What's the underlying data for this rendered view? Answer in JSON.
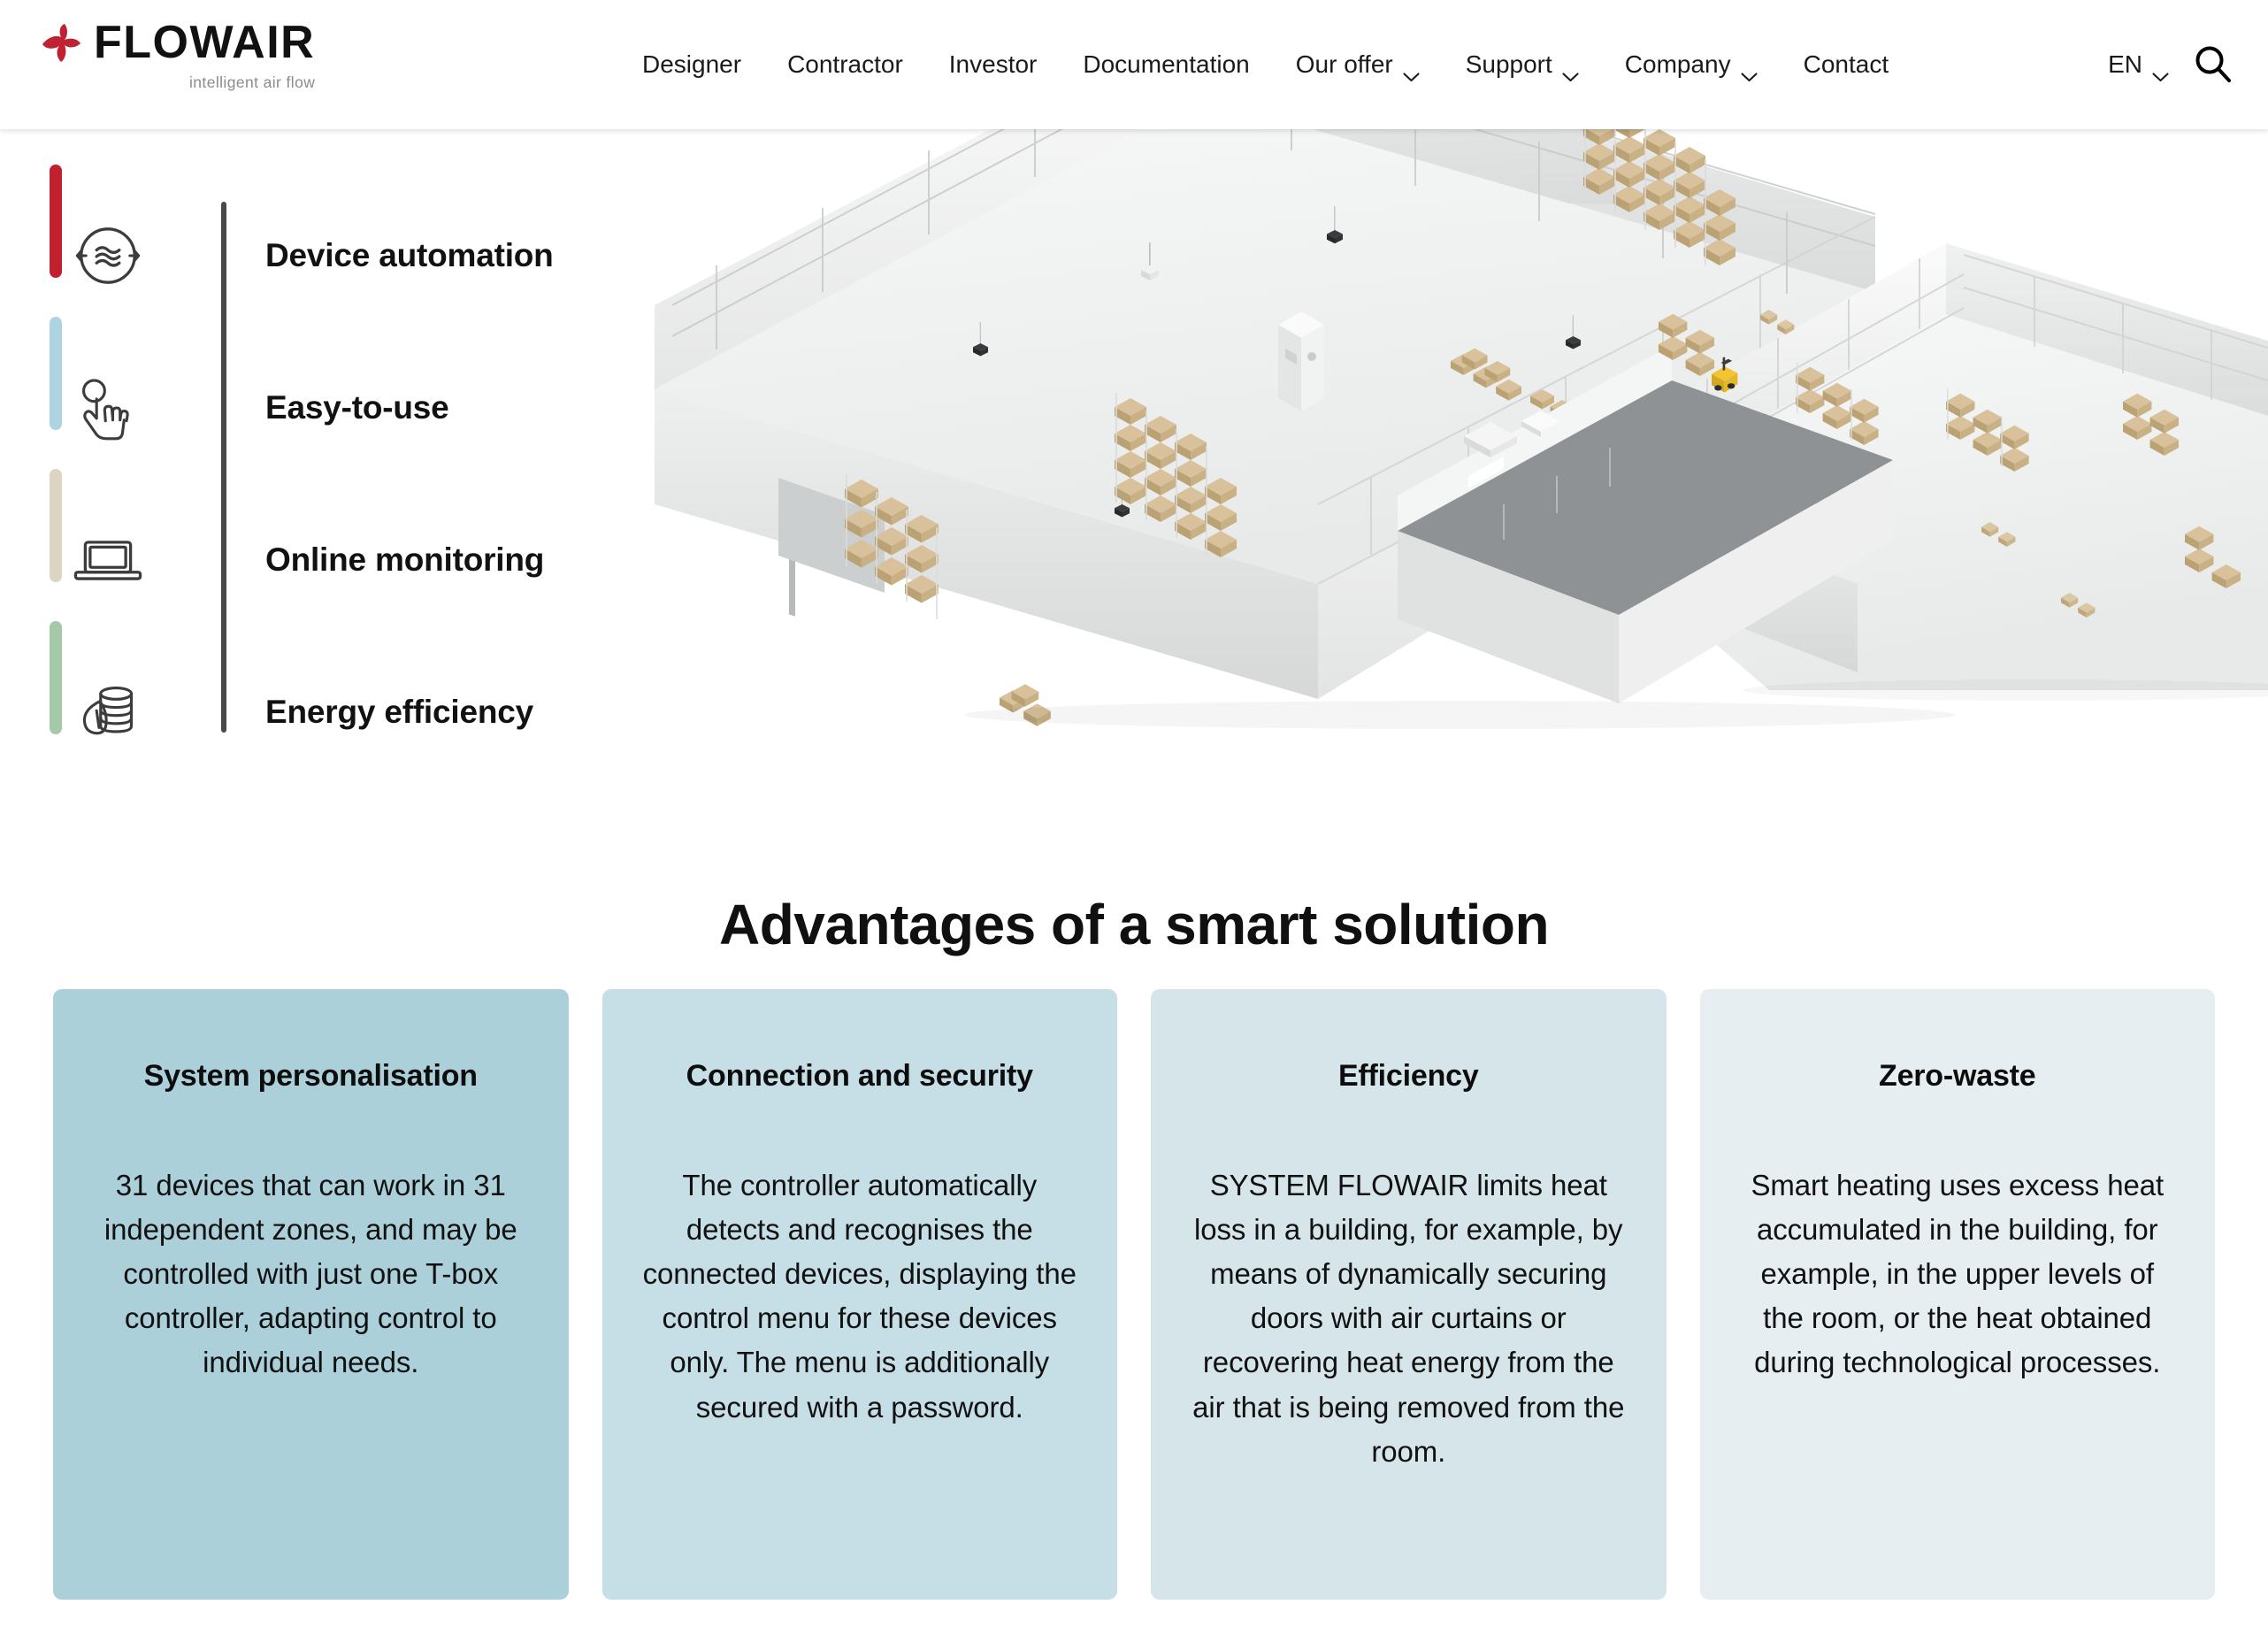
{
  "brand": {
    "name": "FLOWAIR",
    "tagline": "intelligent air flow",
    "mark_color": "#bf2233"
  },
  "nav": {
    "items": [
      {
        "label": "Designer",
        "has_dropdown": false
      },
      {
        "label": "Contractor",
        "has_dropdown": false
      },
      {
        "label": "Investor",
        "has_dropdown": false
      },
      {
        "label": "Documentation",
        "has_dropdown": false
      },
      {
        "label": "Our offer",
        "has_dropdown": true
      },
      {
        "label": "Support",
        "has_dropdown": true
      },
      {
        "label": "Company",
        "has_dropdown": true
      },
      {
        "label": "Contact",
        "has_dropdown": false
      }
    ],
    "language": "EN",
    "search_icon": "search-icon"
  },
  "hero": {
    "features": [
      {
        "label": "Device automation",
        "icon": "air-circulation-icon",
        "accent": "#c1202e"
      },
      {
        "label": "Easy-to-use",
        "icon": "tap-hand-icon",
        "accent": "#aed4e2"
      },
      {
        "label": "Online monitoring",
        "icon": "laptop-icon",
        "accent": "#ddd4c4"
      },
      {
        "label": "Energy efficiency",
        "icon": "coins-leaf-icon",
        "accent": "#a5c9a8"
      }
    ],
    "image_alt": "Isometric 3D rendering of a warehouse and office building interior with pallet racks, forklifts and air handling devices"
  },
  "section": {
    "title": "Advantages of a smart solution"
  },
  "cards": [
    {
      "title": "System personalisation",
      "body": "31 devices that can work in 31 independent zones, and may be controlled with just one T-box controller, adapting control to individual needs.",
      "bg": "#abd0da"
    },
    {
      "title": "Connection and security",
      "body": "The controller automatically detects and recognises the connected devices, displaying the control menu for these devices only. The menu is additionally secured with a password.",
      "bg": "#c6dee5"
    },
    {
      "title": "Efficiency",
      "body": "SYSTEM FLOWAIR limits heat loss in a building, for example, by means of dynamically securing doors with air curtains or recovering heat energy from the air that is being removed from the room.",
      "bg": "#d5e5ea"
    },
    {
      "title": "Zero-waste",
      "body": "Smart heating uses excess heat accumulated in the building, for example, in the upper levels of the room, or the heat obtained during technological processes.",
      "bg": "#e6eef1"
    }
  ]
}
